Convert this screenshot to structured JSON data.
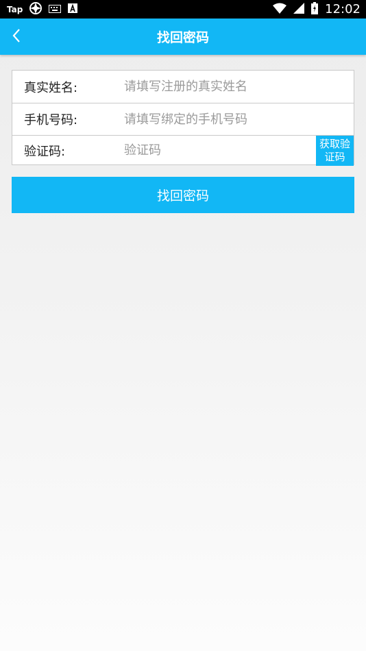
{
  "status_bar": {
    "app_label": "Tap",
    "icons": [
      "tap-app-icon",
      "aperture-icon",
      "keyboard-icon",
      "text-icon",
      "wifi-icon",
      "signal-icon",
      "battery-icon"
    ],
    "time": "12:02"
  },
  "header": {
    "title": "找回密码",
    "back_icon": "chevron-left-icon"
  },
  "form": {
    "name_label": "真实姓名:",
    "name_placeholder": "请填写注册的真实姓名",
    "phone_label": "手机号码:",
    "phone_placeholder": "请填写绑定的手机号码",
    "code_label": "验证码:",
    "code_placeholder": "验证码",
    "get_code_label": "获取验证码"
  },
  "submit_label": "找回密码",
  "colors": {
    "accent": "#12b7f5",
    "border": "#c9c9c9"
  }
}
